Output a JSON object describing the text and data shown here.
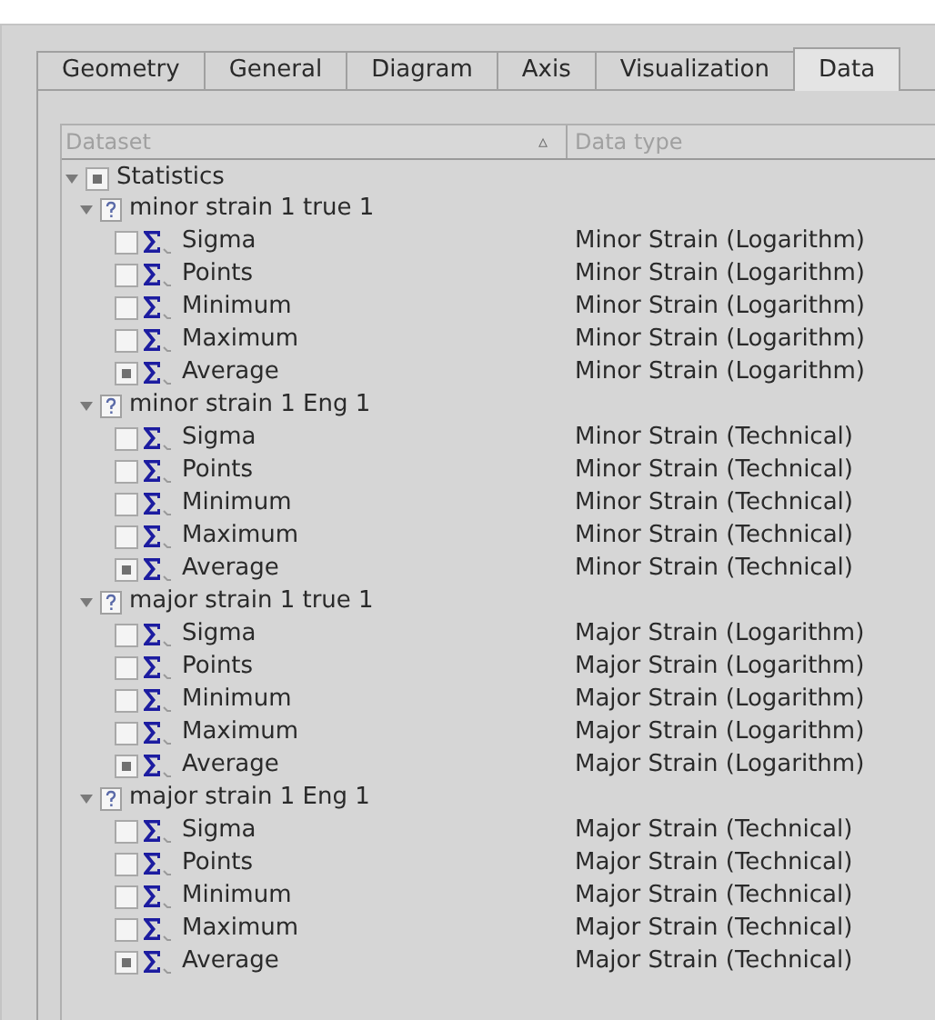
{
  "tabs": [
    {
      "label": "Geometry",
      "selected": false
    },
    {
      "label": "General",
      "selected": false
    },
    {
      "label": "Diagram",
      "selected": false
    },
    {
      "label": "Axis",
      "selected": false
    },
    {
      "label": "Visualization",
      "selected": false
    },
    {
      "label": "Data",
      "selected": true
    }
  ],
  "table": {
    "columns": [
      {
        "label": "Dataset",
        "sort_icon": "▵"
      },
      {
        "label": "Data type"
      }
    ],
    "tree": {
      "label": "Statistics",
      "checked": true,
      "expanded": true,
      "children": [
        {
          "label": "minor strain 1 true 1",
          "expanded": true,
          "children": [
            {
              "label": "Sigma",
              "checked": false,
              "type": "Minor Strain (Logarithm)"
            },
            {
              "label": "Points",
              "checked": false,
              "type": "Minor Strain (Logarithm)"
            },
            {
              "label": "Minimum",
              "checked": false,
              "type": "Minor Strain (Logarithm)"
            },
            {
              "label": "Maximum",
              "checked": false,
              "type": "Minor Strain (Logarithm)"
            },
            {
              "label": "Average",
              "checked": true,
              "type": "Minor Strain (Logarithm)"
            }
          ]
        },
        {
          "label": "minor strain 1 Eng 1",
          "expanded": true,
          "children": [
            {
              "label": "Sigma",
              "checked": false,
              "type": "Minor Strain (Technical)"
            },
            {
              "label": "Points",
              "checked": false,
              "type": "Minor Strain (Technical)"
            },
            {
              "label": "Minimum",
              "checked": false,
              "type": "Minor Strain (Technical)"
            },
            {
              "label": "Maximum",
              "checked": false,
              "type": "Minor Strain (Technical)"
            },
            {
              "label": "Average",
              "checked": true,
              "type": "Minor Strain (Technical)"
            }
          ]
        },
        {
          "label": "major strain 1 true 1",
          "expanded": true,
          "children": [
            {
              "label": "Sigma",
              "checked": false,
              "type": "Major Strain (Logarithm)"
            },
            {
              "label": "Points",
              "checked": false,
              "type": "Major Strain (Logarithm)"
            },
            {
              "label": "Minimum",
              "checked": false,
              "type": "Major Strain (Logarithm)"
            },
            {
              "label": "Maximum",
              "checked": false,
              "type": "Major Strain (Logarithm)"
            },
            {
              "label": "Average",
              "checked": true,
              "type": "Major Strain (Logarithm)"
            }
          ]
        },
        {
          "label": "major strain 1 Eng 1",
          "expanded": true,
          "children": [
            {
              "label": "Sigma",
              "checked": false,
              "type": "Major Strain (Technical)"
            },
            {
              "label": "Points",
              "checked": false,
              "type": "Major Strain (Technical)"
            },
            {
              "label": "Minimum",
              "checked": false,
              "type": "Major Strain (Technical)"
            },
            {
              "label": "Maximum",
              "checked": false,
              "type": "Major Strain (Technical)"
            },
            {
              "label": "Average",
              "checked": true,
              "type": "Major Strain (Technical)"
            }
          ]
        }
      ]
    }
  }
}
